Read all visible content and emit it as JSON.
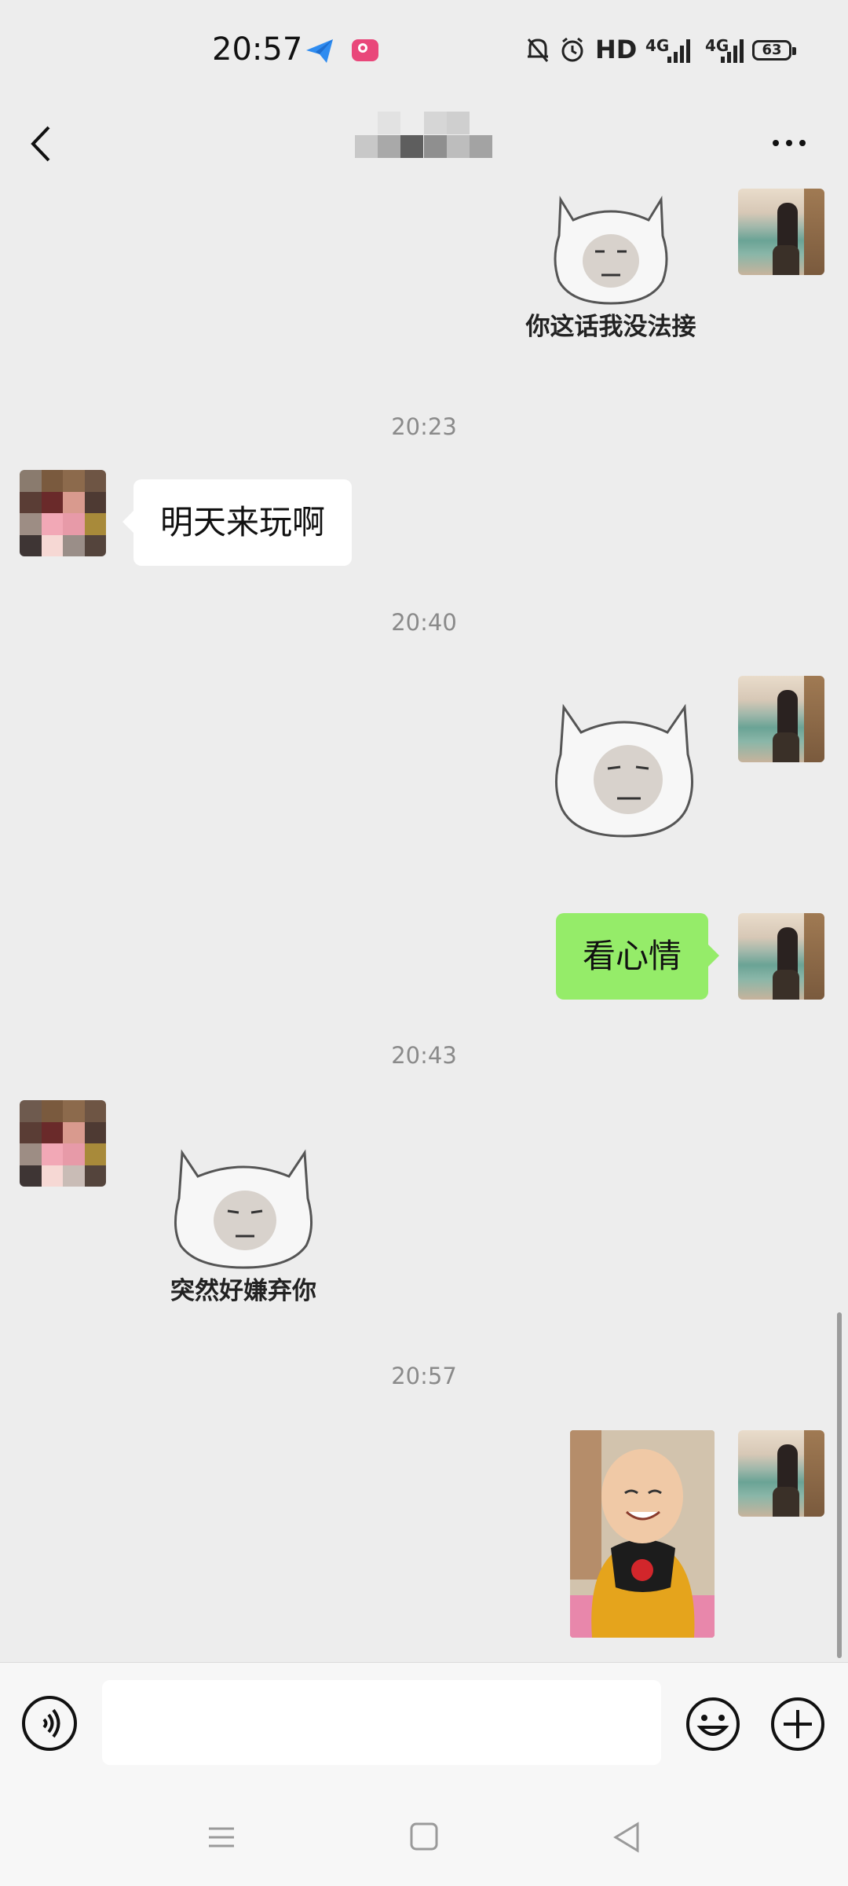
{
  "status_bar": {
    "time": "20:57",
    "hd": "HD",
    "network_1": "4G",
    "network_2": "4G",
    "battery": "63"
  },
  "header": {
    "contact_name_obscured": true
  },
  "messages": [
    {
      "type": "sticker",
      "side": "right",
      "caption": "你这话我没法接"
    },
    {
      "type": "timestamp",
      "text": "20:23"
    },
    {
      "type": "text",
      "side": "left",
      "text": "明天来玩啊"
    },
    {
      "type": "timestamp",
      "text": "20:40"
    },
    {
      "type": "sticker",
      "side": "right",
      "caption": ""
    },
    {
      "type": "text",
      "side": "right",
      "text": "看心情"
    },
    {
      "type": "timestamp",
      "text": "20:43"
    },
    {
      "type": "sticker",
      "side": "left",
      "caption": "突然好嫌弃你"
    },
    {
      "type": "timestamp",
      "text": "20:57"
    },
    {
      "type": "image",
      "side": "right"
    }
  ],
  "input": {
    "value": "",
    "placeholder": ""
  },
  "icons": {
    "back": "chevron-left-icon",
    "more": "more-dots-icon",
    "voice": "voice-icon",
    "emoji": "emoji-icon",
    "plus": "plus-icon",
    "nav_menu": "menu-icon",
    "nav_home": "home-icon",
    "nav_back": "back-triangle-icon"
  },
  "colors": {
    "background": "#ededed",
    "bubble_self": "#95ec69",
    "bubble_other": "#ffffff",
    "timestamp": "#8a8a8a"
  }
}
